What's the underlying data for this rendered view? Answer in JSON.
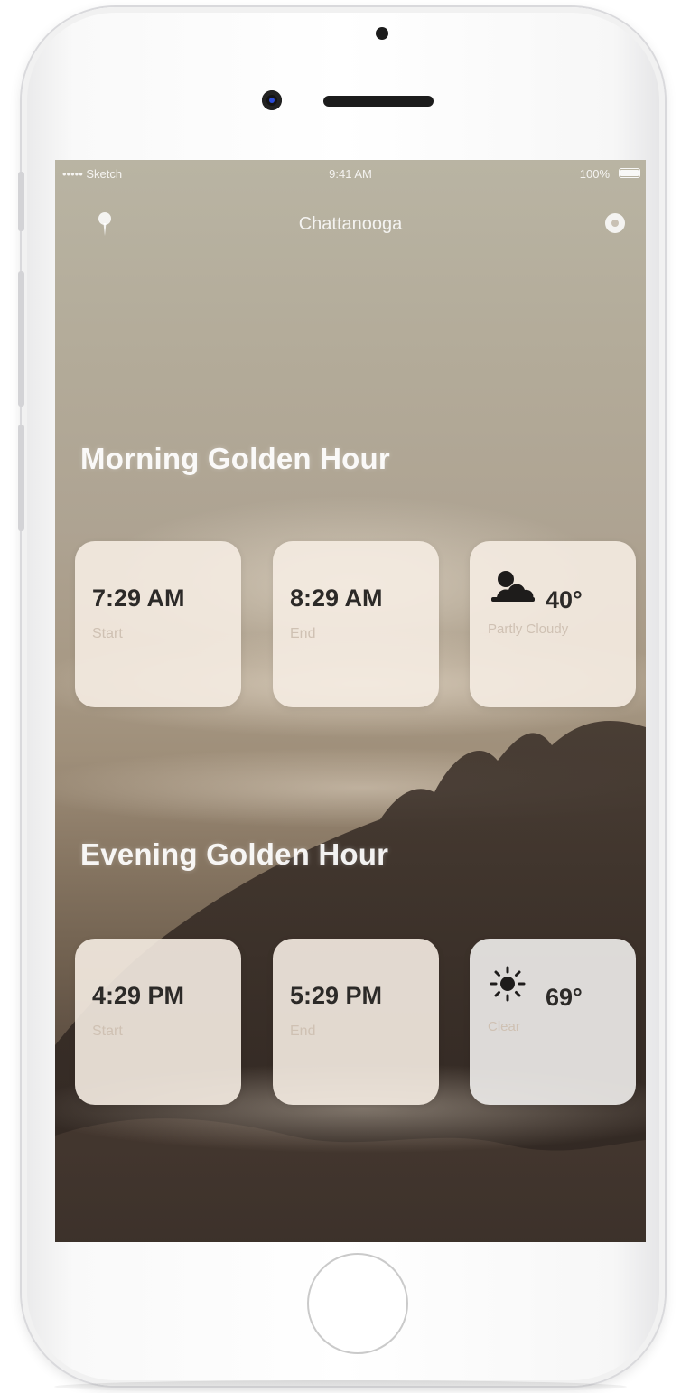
{
  "status_bar": {
    "carrier": "••••• Sketch",
    "time": "9:41 AM",
    "battery": "100%"
  },
  "nav": {
    "title": "Chattanooga",
    "location_icon": "location-pin-icon",
    "settings_icon": "settings-icon"
  },
  "morning": {
    "title": "Morning Golden Hour",
    "start": {
      "time": "7:29 AM",
      "label": "Start"
    },
    "end": {
      "time": "8:29 AM",
      "label": "End"
    },
    "weather": {
      "icon": "partly-cloudy-icon",
      "temp": "40°",
      "condition": "Partly Cloudy"
    }
  },
  "evening": {
    "title": "Evening Golden Hour",
    "start": {
      "time": "4:29 PM",
      "label": "Start"
    },
    "end": {
      "time": "5:29 PM",
      "label": "End"
    },
    "weather": {
      "icon": "sun-icon",
      "temp": "69°",
      "condition": "Clear"
    }
  },
  "colors": {
    "card_background": "#f5ece2",
    "card_text": "#2c2a28",
    "card_label": "#cfc1b3"
  }
}
